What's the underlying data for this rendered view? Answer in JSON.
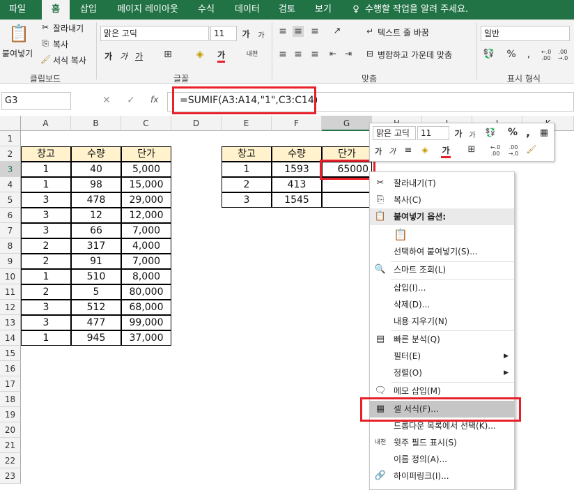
{
  "ribbon_tabs": [
    "파일",
    "홈",
    "삽입",
    "페이지 레이아웃",
    "수식",
    "데이터",
    "검토",
    "보기"
  ],
  "tell_me": "수행할 작업을 알려 주세요.",
  "clipboard": {
    "paste": "붙여넣기",
    "cut": "잘라내기",
    "copy": "복사",
    "format_painter": "서식 복사",
    "group": "클립보드"
  },
  "font": {
    "name": "맑은 고딕",
    "size": "11",
    "group": "글꼴",
    "bold": "가",
    "italic": "가",
    "underline": "가",
    "font_color": "가"
  },
  "alignment": {
    "wrap": "텍스트 줄 바꿈",
    "merge": "병합하고 가운데 맞춤",
    "group": "맞춤"
  },
  "number": {
    "format": "일반",
    "group": "표시 형식"
  },
  "name_box": "G3",
  "formula": "=SUMIF(A3:A14,\"1\",C3:C14)",
  "fx": "fx",
  "columns": [
    "A",
    "B",
    "C",
    "D",
    "E",
    "F",
    "G",
    "H",
    "I",
    "J",
    "K"
  ],
  "rows": [
    "1",
    "2",
    "3",
    "4",
    "5",
    "6",
    "7",
    "8",
    "9",
    "10",
    "11",
    "12",
    "13",
    "14",
    "15",
    "16",
    "17",
    "18",
    "19",
    "20",
    "21",
    "22",
    "23"
  ],
  "table1": {
    "headers": [
      "창고",
      "수량",
      "단가"
    ],
    "rows": [
      [
        "1",
        "40",
        "5,000"
      ],
      [
        "1",
        "98",
        "15,000"
      ],
      [
        "3",
        "478",
        "29,000"
      ],
      [
        "3",
        "12",
        "12,000"
      ],
      [
        "3",
        "66",
        "7,000"
      ],
      [
        "2",
        "317",
        "4,000"
      ],
      [
        "2",
        "91",
        "7,000"
      ],
      [
        "1",
        "510",
        "8,000"
      ],
      [
        "2",
        "5",
        "80,000"
      ],
      [
        "3",
        "512",
        "68,000"
      ],
      [
        "3",
        "477",
        "99,000"
      ],
      [
        "1",
        "945",
        "37,000"
      ]
    ]
  },
  "table2": {
    "headers": [
      "창고",
      "수량",
      "단가"
    ],
    "rows": [
      [
        "1",
        "1593",
        "65000"
      ],
      [
        "2",
        "413",
        ""
      ],
      [
        "3",
        "1545",
        ""
      ]
    ]
  },
  "mini_toolbar": {
    "font": "맑은 고딕",
    "size": "11",
    "percent": "%",
    "comma": ","
  },
  "context_menu": {
    "items": [
      "잘라내기(T)",
      "복사(C)",
      "붙여넣기 옵션:",
      "선택하여 붙여넣기(S)...",
      "스마트 조회(L)",
      "삽입(I)...",
      "삭제(D)...",
      "내용 지우기(N)",
      "빠른 분석(Q)",
      "필터(E)",
      "정렬(O)",
      "메모 삽입(M)",
      "셀 서식(F)...",
      "드롭다운 목록에서 선택(K)...",
      "윗주 필드 표시(S)",
      "이름 정의(A)...",
      "하이퍼링크(I)..."
    ]
  },
  "colors": {
    "accent": "#217346",
    "highlight": "#e8202a",
    "header_fill": "#fff2cc"
  }
}
